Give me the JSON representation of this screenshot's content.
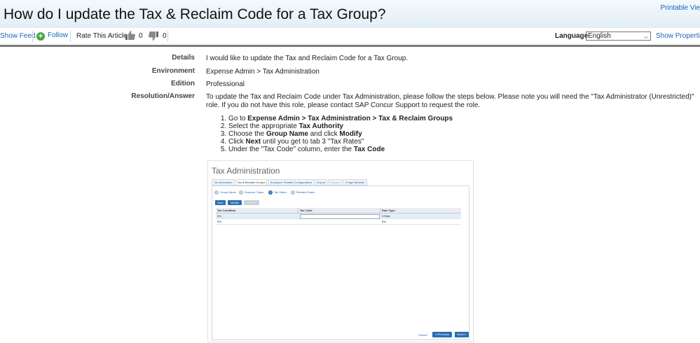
{
  "header": {
    "title": "How do I update the Tax & Reclaim Code for a Tax Group?",
    "printable_view": "Printable Vie"
  },
  "toolbar": {
    "show_feed": "Show Feed",
    "follow": "Follow",
    "rate_label": "Rate This Article",
    "thumbs_up_count": "0",
    "thumbs_down_count": "0",
    "language_label": "Language",
    "language_value": "English",
    "show_properties": "Show Properties"
  },
  "article": {
    "details_label": "Details",
    "details_value": "I would like to update the Tax and Reclaim Code for a Tax Group.",
    "environment_label": "Environment",
    "environment_value": "Expense Admin > Tax Administration",
    "edition_label": "Edition",
    "edition_value": "Professional",
    "resolution_label": "Resolution/Answer",
    "resolution_text": "To update the Tax and Reclaim Code under Tax Administration, please follow the steps below. Please note you will need the \"Tax Administrator (Unrestricted)\" role. If you do not have this role, please contact SAP Concur Support to request the role.",
    "steps": [
      {
        "pre": "Go to ",
        "bold": "Expense Admin > Tax Administration > Tax & Reclaim Groups",
        "post": ""
      },
      {
        "pre": "Select the appropriate ",
        "bold": "Tax Authority",
        "post": ""
      },
      {
        "pre": "Choose the ",
        "bold": "Group Name",
        "post": " and click ",
        "bold2": "Modify"
      },
      {
        "pre": "Click ",
        "bold": "Next",
        "post": " until you get to tab 3 \"Tax Rates\""
      },
      {
        "pre": "Under the \"Tax Code\" column, enter the ",
        "bold": "Tax Code",
        "post": ""
      }
    ]
  },
  "screenshot": {
    "title": "Tax Administration",
    "tabs": [
      "Tax Authorities",
      "Tax & Reclaim Groups",
      "Employee Related Configurations",
      "Export",
      "Reports",
      "Fringe Benefits"
    ],
    "wizard_steps": [
      {
        "num": "1",
        "label": "Group Name"
      },
      {
        "num": "2",
        "label": "Expense Types"
      },
      {
        "num": "3",
        "label": "Tax Rates"
      },
      {
        "num": "4",
        "label": "Reclaim Rates"
      }
    ],
    "buttons": [
      "New",
      "Modify",
      "Delete"
    ],
    "columns": [
      "Tax Condition",
      "Tax Code",
      "Rate Type"
    ],
    "rows": [
      [
        "0%",
        "",
        "0 Rate"
      ],
      [
        "5%",
        "",
        "5%"
      ]
    ],
    "cancel": "Cancel",
    "previous": "<<Previous",
    "next": "Next>>"
  }
}
